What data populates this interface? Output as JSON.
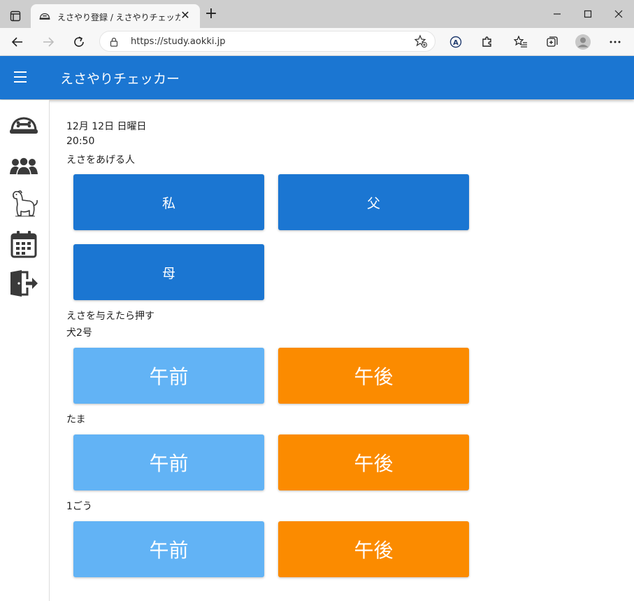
{
  "browser": {
    "tab_title": "えさやり登録 / えさやりチェッカー",
    "tab_close": "✕",
    "new_tab": "+",
    "url": "https://study.aokki.jp"
  },
  "appbar": {
    "title": "えさやりチェッカー"
  },
  "sidebar": {
    "items": [
      {
        "icon": "dog-bowl-icon"
      },
      {
        "icon": "people-icon"
      },
      {
        "icon": "dog-icon"
      },
      {
        "icon": "calendar-icon"
      },
      {
        "icon": "logout-door-icon"
      }
    ]
  },
  "main": {
    "date": "12月 12日 日曜日",
    "time": "20:50",
    "feeder_label": "えさをあげる人",
    "feeders": [
      "私",
      "父",
      "母"
    ],
    "instruction": "えさを与えたら押す",
    "am_label": "午前",
    "pm_label": "午後",
    "dogs": [
      {
        "name": "犬2号"
      },
      {
        "name": "たま"
      },
      {
        "name": "1ごう"
      }
    ]
  },
  "colors": {
    "appbar": "#1b76d2",
    "person_button": "#1b76d2",
    "am_button": "#62b3f5",
    "pm_button": "#fb8b00"
  }
}
